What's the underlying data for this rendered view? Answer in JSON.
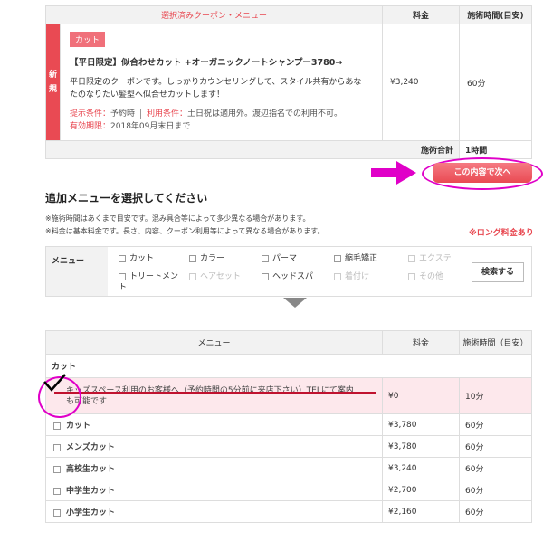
{
  "coupon_table": {
    "header_selected": "選択済みクーポン・メニュー",
    "header_price": "料金",
    "header_time": "施術時間(目安)",
    "new_badge": "新規",
    "tag": "カット",
    "title": "【平日限定】似合わせカット +オーガニックノートシャンプー3780→",
    "description_line1": "平日限定のクーポンです。しっかりカウンセリングして、スタイル共有からあな",
    "description_line2": "たのなりたい髪型へ似合せカットします！",
    "condition_label1": "提示条件：",
    "condition_value1": "予約時",
    "condition_label2": "利用条件：",
    "condition_value2": "土日祝は適用外。渡辺指名での利用不可。",
    "expiry_label": "有効期限：",
    "expiry_value": "2018年09月末日まで",
    "price": "¥3,240",
    "time": "60分",
    "total_label": "施術合計",
    "total_value": "1時間"
  },
  "next_button_label": "この内容で次へ",
  "additional": {
    "title": "追加メニューを選択してください",
    "note1": "※施術時間はあくまで目安です。混み具合等によって多少異なる場合があります。",
    "note2": "※料金は基本料金です。長さ、内容、クーポン利用等によって異なる場合があります。",
    "long_fee": "※ロング料金あり"
  },
  "filter": {
    "label": "メニュー",
    "options": [
      {
        "label": "カット",
        "enabled": true
      },
      {
        "label": "カラー",
        "enabled": true
      },
      {
        "label": "パーマ",
        "enabled": true
      },
      {
        "label": "縮毛矯正",
        "enabled": true
      },
      {
        "label": "エクステ",
        "enabled": false
      },
      {
        "label": "トリートメン",
        "enabled": true
      },
      {
        "label": "ヘアセット",
        "enabled": false
      },
      {
        "label": "ヘッドスパ",
        "enabled": true
      },
      {
        "label": "着付け",
        "enabled": false
      },
      {
        "label": "その他",
        "enabled": false
      }
    ],
    "option_wrap": "ト",
    "search_button": "検索する"
  },
  "menu_table": {
    "header_menu": "メニュー",
    "header_price": "料金",
    "header_time": "施術時間（目安）",
    "category": "カット",
    "rows": [
      {
        "name": "キッズスペース利用のお客様へ（予約時間の5分前に来店下さい）TELにて案内",
        "name2": "も可能です",
        "price": "¥0",
        "time": "10分"
      },
      {
        "name": "カット",
        "price": "¥3,780",
        "time": "60分"
      },
      {
        "name": "メンズカット",
        "price": "¥3,780",
        "time": "60分"
      },
      {
        "name": "高校生カット",
        "price": "¥3,240",
        "time": "60分"
      },
      {
        "name": "中学生カット",
        "price": "¥2,700",
        "time": "60分"
      },
      {
        "name": "小学生カット",
        "price": "¥2,160",
        "time": "60分"
      }
    ]
  }
}
